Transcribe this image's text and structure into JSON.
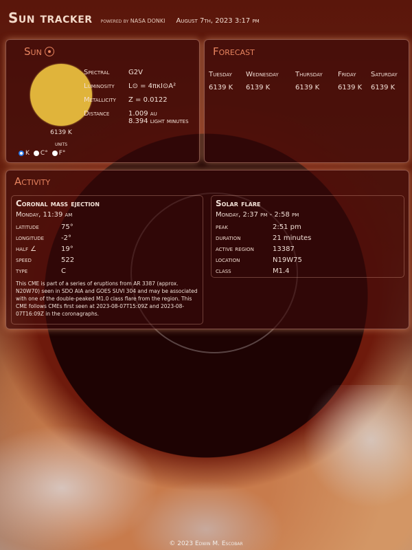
{
  "header": {
    "title": "Sun tracker",
    "powered": "powered by NASA DONKI",
    "datetime": "August 7th, 2023 3:17 pm"
  },
  "sun": {
    "title": "Sun",
    "temperature": "6139 K",
    "units_label": "units",
    "unit_options": [
      "K",
      "C°",
      "F°"
    ],
    "selected_unit": "K",
    "disc_color": "#e0b43b",
    "properties": [
      {
        "key": "Spectral",
        "value": "G2V"
      },
      {
        "key": "Luminosity",
        "value": "L⊙ = 4πκI⊙A²"
      },
      {
        "key": "Metallicity",
        "value": "Z = 0.0122"
      },
      {
        "key": "Distance",
        "value": "1.009 au",
        "value2": "8.394 light minutes"
      }
    ]
  },
  "forecast": {
    "title": "Forecast",
    "days": [
      {
        "day": "Tuesday",
        "temp": "6139 K"
      },
      {
        "day": "Wednesday",
        "temp": "6139 K"
      },
      {
        "day": "Thursday",
        "temp": "6139 K"
      },
      {
        "day": "Friday",
        "temp": "6139 K"
      },
      {
        "day": "Saturday",
        "temp": "6139 K"
      }
    ]
  },
  "activity": {
    "title": "Activity",
    "cme": {
      "title": "Coronal mass ejection",
      "time": "Monday, 11:39 am",
      "rows": [
        {
          "key": "latitude",
          "value": "75°"
        },
        {
          "key": "longitude",
          "value": "-2°"
        },
        {
          "key": "half ∠",
          "value": "19°"
        },
        {
          "key": "speed",
          "value": "522"
        },
        {
          "key": "type",
          "value": "C"
        }
      ],
      "description": "This CME is part of a series of eruptions from AR 3387 (approx. N20W70) seen in SDO AIA and GOES SUVI 304 and may be associated with one of the double-peaked M1.0 class flare from the region. This CME follows CMEs first seen at 2023-08-07T15:09Z and 2023-08-07T16:09Z in the coronagraphs."
    },
    "flare": {
      "title": "Solar flare",
      "time": "Monday, 2:37 pm - 2:58 pm",
      "rows": [
        {
          "key": "peak",
          "value": "2:51 pm"
        },
        {
          "key": "duration",
          "value": "21 minutes"
        },
        {
          "key": "active region",
          "value": "13387"
        },
        {
          "key": "location",
          "value": "N19W75"
        },
        {
          "key": "class",
          "value": "M1.4"
        }
      ]
    }
  },
  "footer": "© 2023 Edwin M. Escobar"
}
